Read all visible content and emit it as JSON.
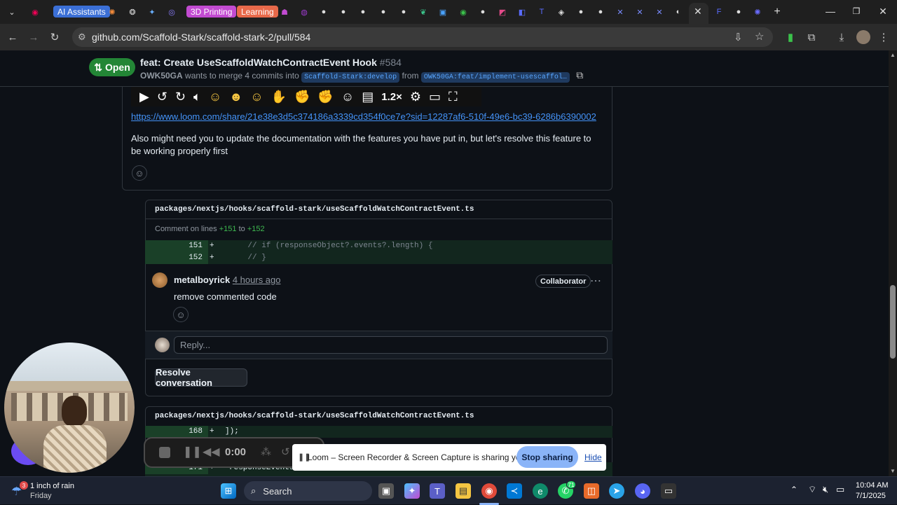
{
  "browser": {
    "tabs": [
      {
        "label": "AI Assistants",
        "color": "#3b6fd6"
      },
      {
        "label": "3D Printing",
        "color": "#c24bd1"
      },
      {
        "label": "Learning",
        "color": "#e8694a"
      }
    ],
    "url": "github.com/Scaffold-Stark/scaffold-stark-2/pull/584"
  },
  "pr": {
    "status": "Open",
    "title": "feat: Create UseScaffoldWatchContractEvent Hook",
    "number": "#584",
    "author": "OWK50GA",
    "merge_text": "wants to merge 4 commits into",
    "base_branch": "Scaffold-Stark:develop",
    "from_text": "from",
    "head_branch": "OWK50GA:feat/implement-usescaffol…"
  },
  "comment1": {
    "loom_link": "https://www.loom.com/share/21e38e3d5c374186a3339cd354f0ce7e?sid=12287af6-510f-49e6-bc39-6286b6390002",
    "body": "Also might need you to update the documentation with the features you have put in, but let's resolve this feature to be working properly first",
    "loom_speed": "1.2×"
  },
  "thread1": {
    "file_path": "packages/nextjs/hooks/scaffold-stark/useScaffoldWatchContractEvent.ts",
    "comment_on_lines_prefix": "Comment on lines",
    "line_start": "+151",
    "to": "to",
    "line_end": "+152",
    "diff": [
      {
        "num": "151",
        "sign": "+",
        "code": "    // if (responseObject?.events?.length) {"
      },
      {
        "num": "152",
        "sign": "+",
        "code": "    // }"
      }
    ],
    "author": "metalboyrick",
    "time": "4 hours ago",
    "role": "Collaborator",
    "body": "remove commented code",
    "reply_placeholder": "Reply...",
    "resolve_label": "Resolve conversation"
  },
  "thread2": {
    "file_path": "packages/nextjs/hooks/scaffold-stark/useScaffoldWatchContractEvent.ts",
    "diff": [
      {
        "num": "168",
        "sign": "+",
        "code": "]);"
      },
      {
        "num": "171",
        "sign": "+",
        "code": "responseEvents"
      }
    ]
  },
  "loom": {
    "timer": "0:00",
    "share_text": "Loom – Screen Recorder & Screen Capture is sharing your screen.",
    "stop_label": "Stop sharing",
    "hide_label": "Hide"
  },
  "taskbar": {
    "weather_badge": "3",
    "weather_text": "1 inch of rain",
    "weather_day": "Friday",
    "search_label": "Search",
    "whatsapp_badge": "71",
    "time": "10:04 AM",
    "date": "7/1/2025"
  }
}
